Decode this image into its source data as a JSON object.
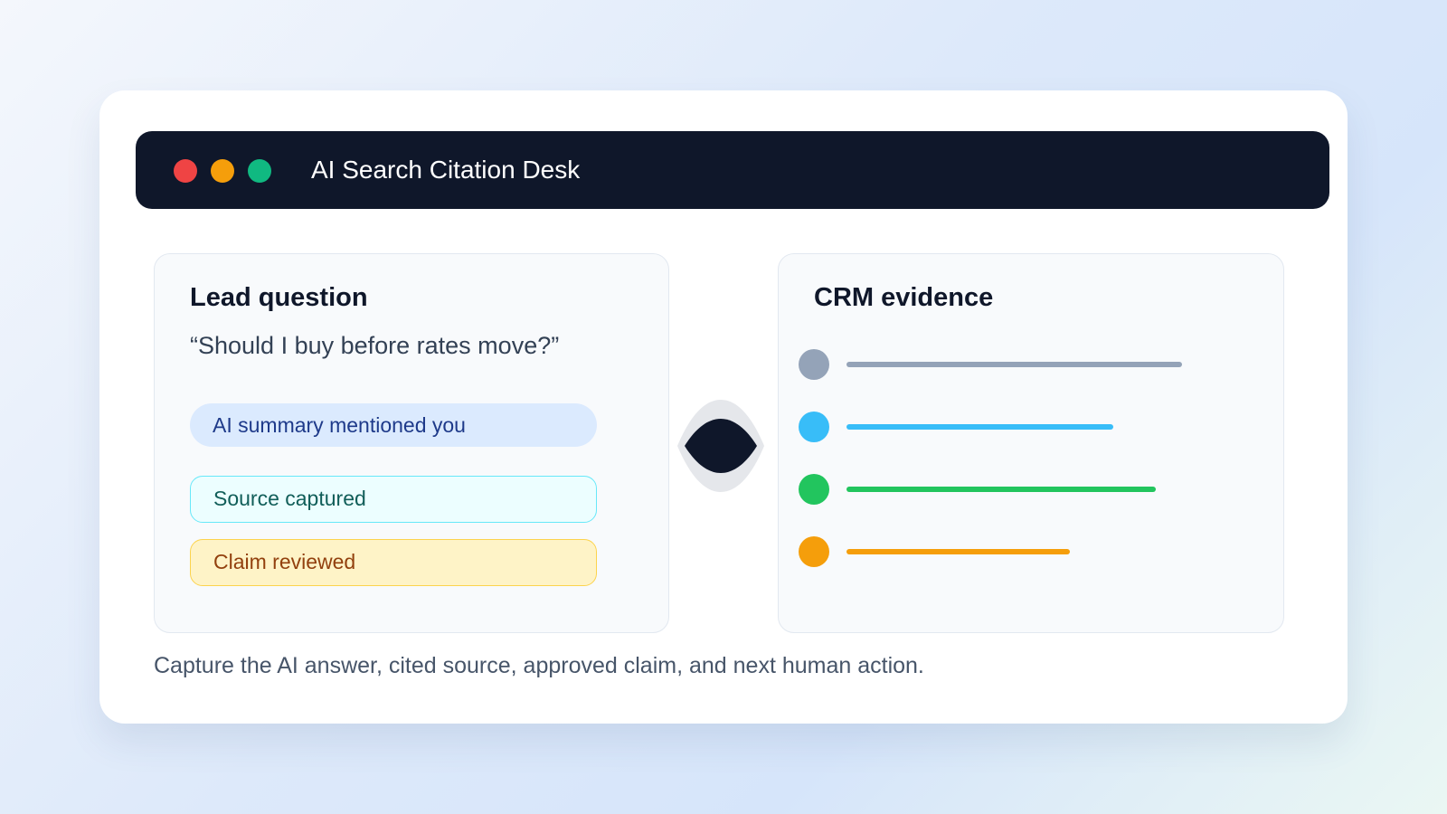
{
  "window": {
    "title": "AI Search Citation Desk",
    "controls": [
      {
        "name": "close",
        "color": "#ef4444"
      },
      {
        "name": "minimize",
        "color": "#f59e0b"
      },
      {
        "name": "maximize",
        "color": "#10b981"
      }
    ]
  },
  "lead_panel": {
    "title": "Lead question",
    "question": "“Should I buy before rates move?”",
    "statuses": [
      {
        "label": "AI summary mentioned you"
      },
      {
        "label": "Source captured"
      },
      {
        "label": "Claim reviewed"
      }
    ]
  },
  "connector": {
    "icon": "eye-icon",
    "color": "#0f172a"
  },
  "crm_panel": {
    "title": "CRM evidence",
    "rows": [
      {
        "color": "#94a3b8",
        "fill": 0.78
      },
      {
        "color": "#38bdf8",
        "fill": 0.62
      },
      {
        "color": "#22c55e",
        "fill": 0.72
      },
      {
        "color": "#f59e0b",
        "fill": 0.52
      }
    ]
  },
  "footer": {
    "caption": "Capture the AI answer, cited source, approved claim, and next human action."
  }
}
